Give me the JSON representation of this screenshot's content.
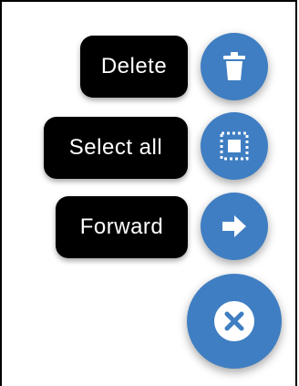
{
  "actions": {
    "delete": {
      "label": "Delete",
      "icon": "trash-icon"
    },
    "select_all": {
      "label": "Select all",
      "icon": "select-all-icon"
    },
    "forward": {
      "label": "Forward",
      "icon": "arrow-right-icon"
    }
  },
  "main_fab": {
    "icon": "close-icon"
  },
  "colors": {
    "fab": "#3f7ec2",
    "label_bg": "#000000",
    "label_text": "#ffffff",
    "icon": "#ffffff"
  }
}
